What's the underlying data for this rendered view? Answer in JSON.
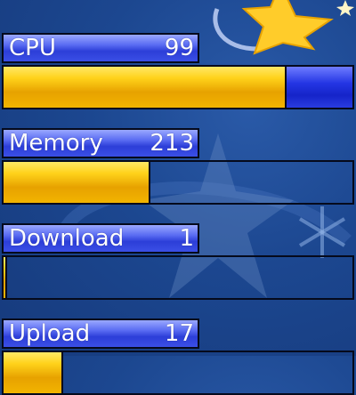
{
  "meters": [
    {
      "label": "CPU",
      "value": "99",
      "level": 0.81,
      "track": "blue"
    },
    {
      "label": "Memory",
      "value": "213",
      "level": 0.42,
      "track": "transparent"
    },
    {
      "label": "Download",
      "value": "1",
      "level": 0.01,
      "track": "transparent"
    },
    {
      "label": "Upload",
      "value": "17",
      "level": 0.17,
      "track": "transparent"
    }
  ],
  "colors": {
    "fill": "#f2b400",
    "label_bar": "#3b4fe6",
    "background": "#1c4790"
  },
  "decorations": [
    "star-icon",
    "watermark-star-icon",
    "snowflake-icon"
  ]
}
